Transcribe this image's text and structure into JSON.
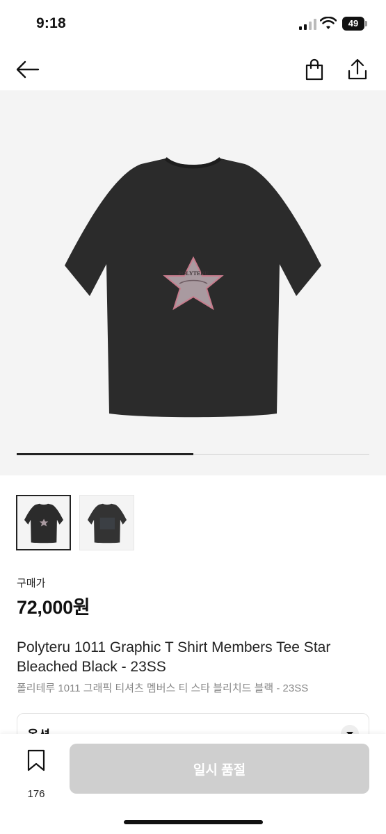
{
  "status_bar": {
    "time": "9:18",
    "battery": "49",
    "icons": [
      "signal-icon",
      "wifi-icon",
      "battery-icon"
    ]
  },
  "nav": {
    "icons": [
      "back-arrow-icon",
      "shopping-bag-icon",
      "share-icon"
    ]
  },
  "gallery": {
    "image_alt": "black t-shirt with star graphic",
    "star_print_text": "POLYTERU",
    "slide_progress": 0.5
  },
  "thumbnails": [
    {
      "name": "thumb-front",
      "active": true
    },
    {
      "name": "thumb-back",
      "active": false
    }
  ],
  "price": {
    "label": "구매가",
    "value": "72,000원"
  },
  "product": {
    "title_en": "Polyteru 1011 Graphic T Shirt Members Tee Star Bleached Black - 23SS",
    "title_ko": "폴리테루 1011 그래픽 티셔츠 멤버스 티 스타 블리치드 블랙 - 23SS"
  },
  "option": {
    "label": "옵션",
    "icon": "chevron-down-icon"
  },
  "bottom_bar": {
    "bookmark_count": "176",
    "button_label": "일시 품절",
    "button_color": "#cfcfcf"
  }
}
